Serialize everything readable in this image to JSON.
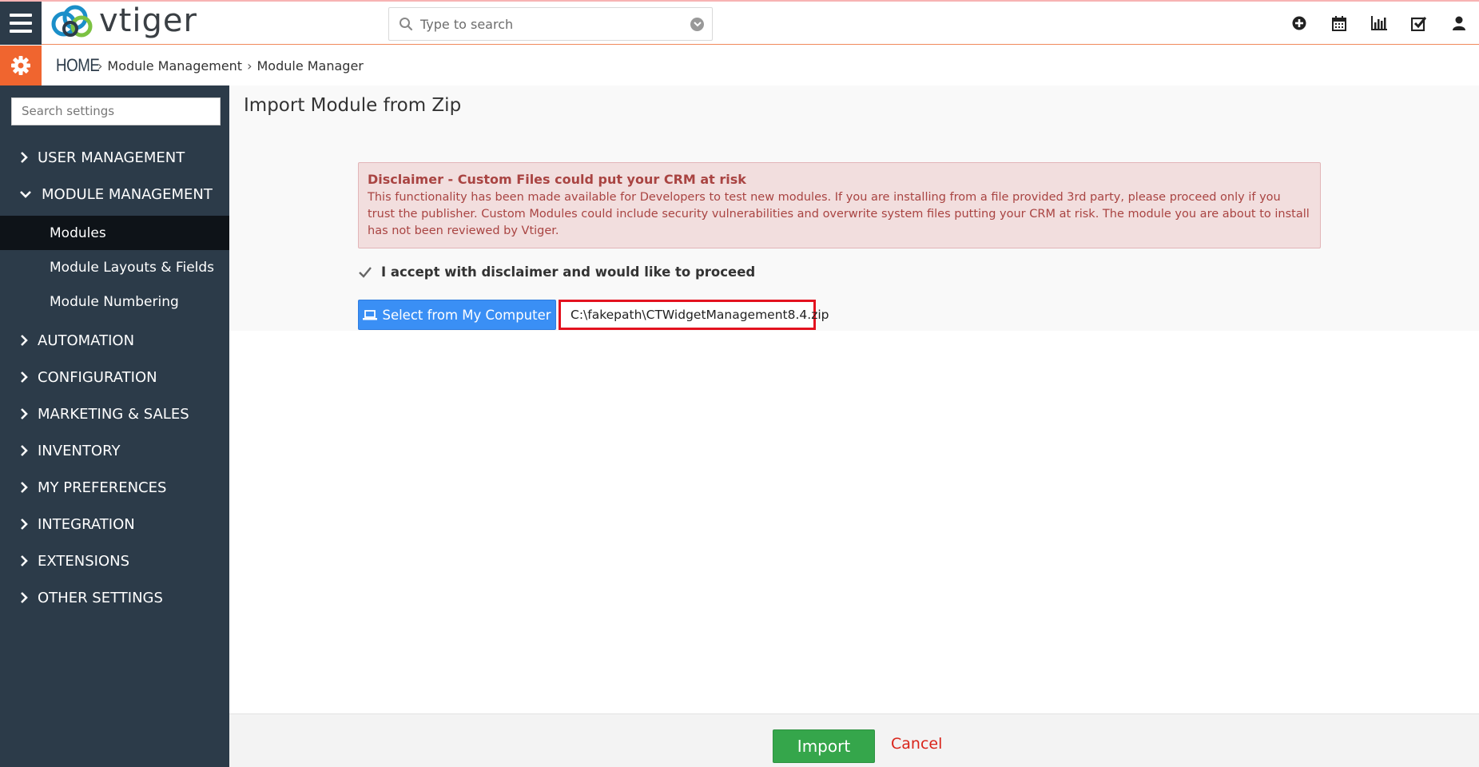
{
  "app": {
    "logo_text": "vtiger"
  },
  "search": {
    "placeholder": "Type to search"
  },
  "header_icons": [
    "plus-circle-icon",
    "calendar-icon",
    "bar-chart-icon",
    "checkbox-icon",
    "user-icon"
  ],
  "breadcrumb": {
    "home": "HOME",
    "items": [
      "Module Management",
      "Module Manager"
    ]
  },
  "sidebar": {
    "search_placeholder": "Search settings",
    "sections": [
      {
        "label": "USER MANAGEMENT",
        "expanded": false
      },
      {
        "label": "MODULE MANAGEMENT",
        "expanded": true,
        "children": [
          {
            "label": "Modules",
            "active": true
          },
          {
            "label": "Module Layouts & Fields",
            "active": false
          },
          {
            "label": "Module Numbering",
            "active": false
          }
        ]
      },
      {
        "label": "AUTOMATION",
        "expanded": false
      },
      {
        "label": "CONFIGURATION",
        "expanded": false
      },
      {
        "label": "MARKETING & SALES",
        "expanded": false
      },
      {
        "label": "INVENTORY",
        "expanded": false
      },
      {
        "label": "MY PREFERENCES",
        "expanded": false
      },
      {
        "label": "INTEGRATION",
        "expanded": false
      },
      {
        "label": "EXTENSIONS",
        "expanded": false
      },
      {
        "label": "OTHER SETTINGS",
        "expanded": false
      }
    ]
  },
  "main": {
    "title": "Import Module from Zip",
    "disclaimer": {
      "title": "Disclaimer - Custom Files could put your CRM at risk",
      "body": "This functionality has been made available for Developers to test new modules. If you are installing from a file provided 3rd party, please proceed only if you trust the publisher. Custom Modules could include security vulnerabilities and overwrite system files putting your CRM at risk. The module you are about to install has not been reviewed by Vtiger."
    },
    "accept_label": "I accept with disclaimer and would like to proceed",
    "accept_checked": true,
    "select_button": "Select from My Computer",
    "selected_file": "C:\\fakepath\\CTWidgetManagement8.4.zip"
  },
  "footer": {
    "import_label": "Import",
    "cancel_label": "Cancel"
  },
  "colors": {
    "sidebar_bg": "#2c3b49",
    "accent_orange": "#f0652f",
    "primary_blue": "#3a8ff5",
    "success_green": "#35a64b",
    "danger_red": "#d9241a",
    "alert_bg": "#f2dede"
  }
}
